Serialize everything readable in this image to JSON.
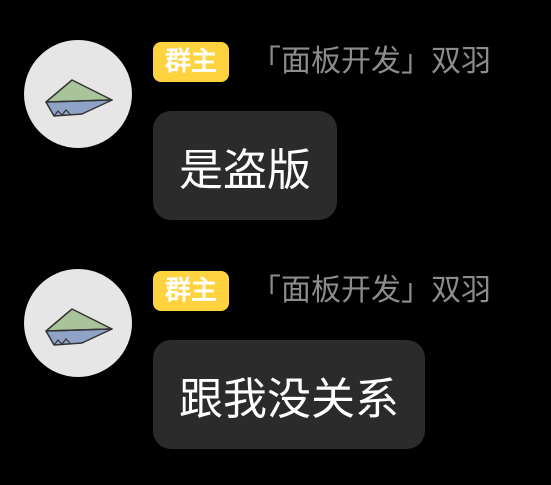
{
  "messages": [
    {
      "role_badge": "群主",
      "sender": "「面板开发」双羽",
      "text": "是盗版",
      "avatar_icon": "paper-airplane-icon"
    },
    {
      "role_badge": "群主",
      "sender": "「面板开发」双羽",
      "text": "跟我没关系",
      "avatar_icon": "paper-airplane-icon"
    }
  ],
  "colors": {
    "background": "#000000",
    "bubble": "#2b2b2b",
    "badge": "#ffd23f",
    "sender_name": "#8c8c8c",
    "avatar_bg": "#e6e6e6"
  }
}
